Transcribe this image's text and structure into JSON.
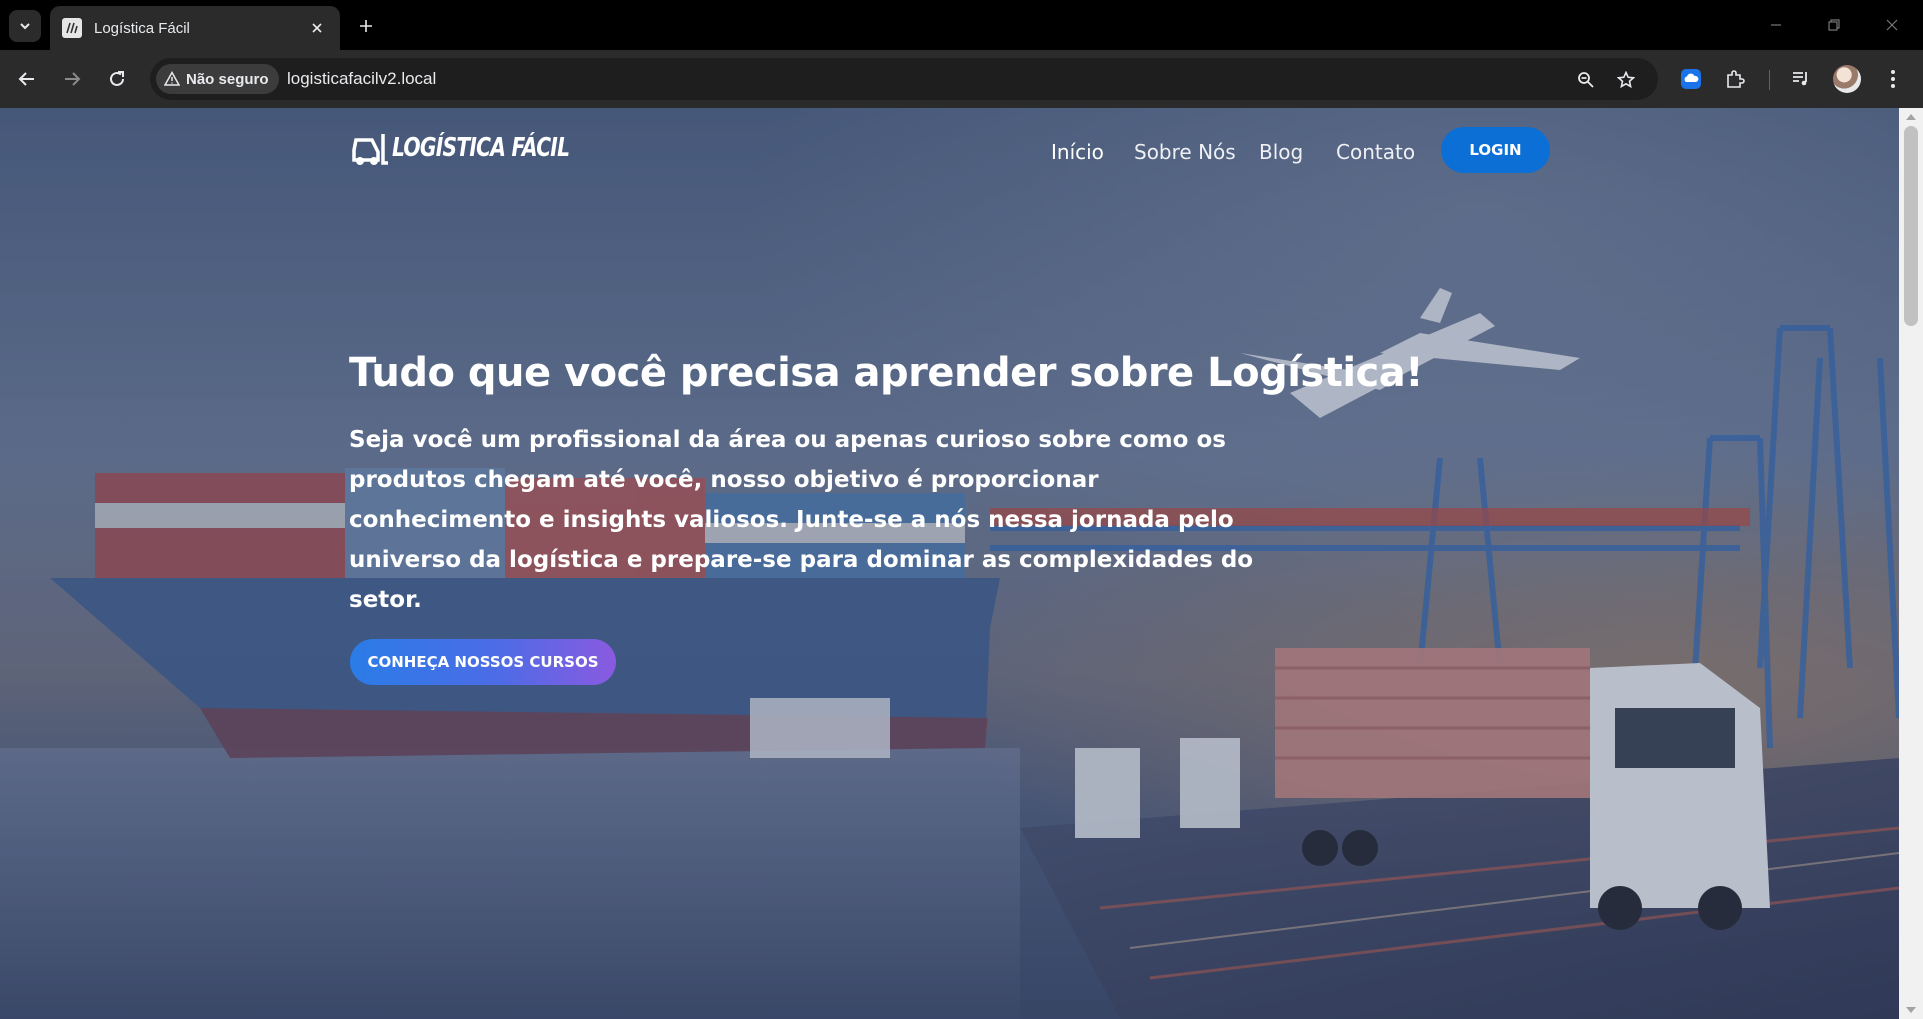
{
  "browser": {
    "tab_title": "Logística Fácil",
    "security_label": "Não seguro",
    "url": "logisticafacilv2.local"
  },
  "site": {
    "logo_text": "LOGÍSTICA FÁCIL",
    "nav": [
      {
        "label": "Início"
      },
      {
        "label": "Sobre Nós"
      },
      {
        "label": "Blog"
      },
      {
        "label": "Contato"
      }
    ],
    "login_label": "LOGIN"
  },
  "hero": {
    "title": "Tudo que você precisa aprender sobre Logística!",
    "text": "Seja você um profissional da área ou apenas curioso sobre como os produtos chegam até você, nosso objetivo é proporcionar conhecimento e insights valiosos. Junte-se a nós nessa jornada pelo universo da logística e prepare-se para dominar as complexidades do setor.",
    "cta_label": "CONHEÇA NOSSOS CURSOS"
  },
  "colors": {
    "login_button": "#0b6fd6",
    "cta_gradient_start": "#2a7ce6",
    "cta_gradient_end": "#8a5ae0"
  }
}
